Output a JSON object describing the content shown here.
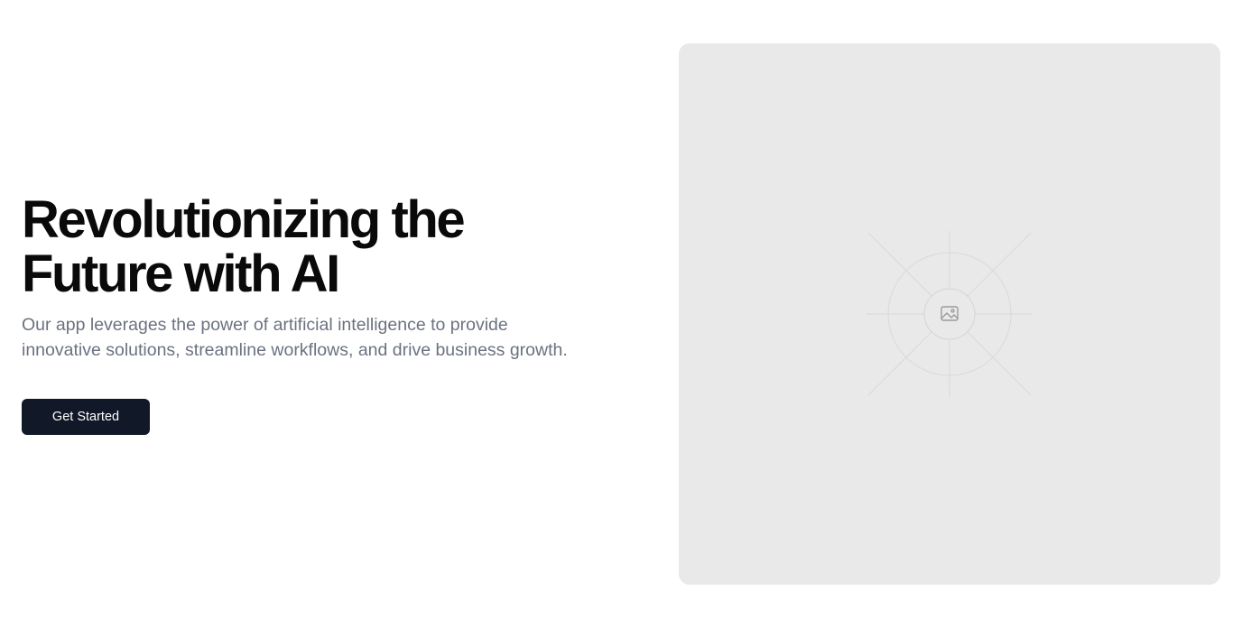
{
  "hero": {
    "title_line1": "Revolutionizing the",
    "title_line2": "Future with AI",
    "description": "Our app leverages the power of artificial intelligence to provide innovative solutions, streamline workflows, and drive business growth.",
    "cta_label": "Get Started"
  },
  "image_placeholder": {
    "icon": "image-icon"
  },
  "colors": {
    "title": "#0a0a0a",
    "description": "#6b7280",
    "button_bg": "#111827",
    "button_text": "#ffffff",
    "placeholder_bg": "#e9e9e9"
  }
}
